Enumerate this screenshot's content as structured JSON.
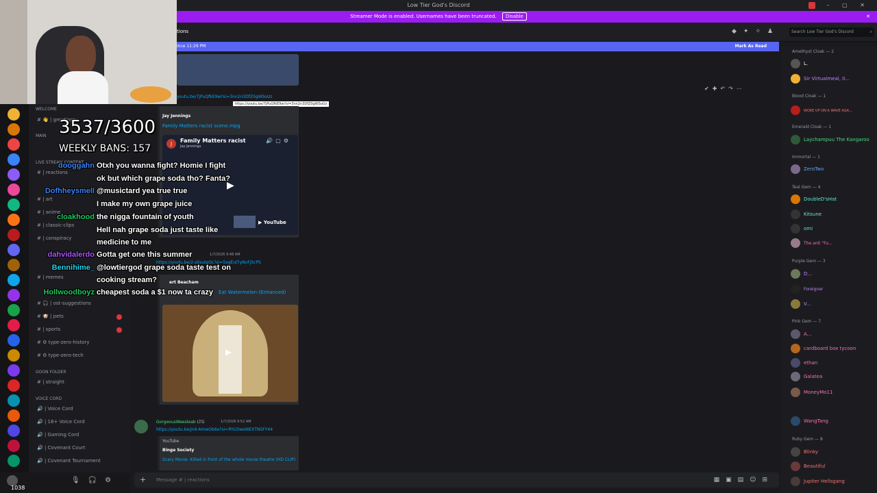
{
  "window": {
    "title": "Low Tier God's Discord"
  },
  "streamer_bar": {
    "text": "Streamer Mode is enabled. Usernames have been truncated.",
    "disable_label": "Disable"
  },
  "header": {
    "channel_partial": "tions",
    "search_placeholder": "Search Low Tier God's Discord"
  },
  "new_messages": {
    "since": "ince 11:29 PM",
    "mark_read": "Mark As Read"
  },
  "overlay": {
    "counter": "3537/3600",
    "weekly_bans": "WEEKLY BANS: 157",
    "chat": [
      {
        "user": "dooggahn",
        "msg": "Otxh you wanna fight? Homie I fight",
        "color": "#3b82f6"
      },
      {
        "user": "",
        "msg": "ok but which grape soda tho? Fanta?",
        "color": "#ffffff"
      },
      {
        "user": "",
        "msg": "@musictard yea true true",
        "color": "#ffffff"
      },
      {
        "user": "Dofhheysmell",
        "msg": "",
        "color": "#3b82f6"
      },
      {
        "user": "",
        "msg": "I make my own grape juice",
        "color": "#ffffff"
      },
      {
        "user": "cloakhood",
        "msg": "the nigga fountain of youth",
        "color": "#22c55e"
      },
      {
        "user": "",
        "msg": "Hell nah grape soda just taste like",
        "color": "#ffffff"
      },
      {
        "user": "",
        "msg": "medicine to me",
        "color": "#ffffff"
      },
      {
        "user": "dahvidalerdo",
        "msg": "Gotta get one this summer",
        "color": "#a855f7"
      },
      {
        "user": "Bennihime_",
        "msg": "@lowtiergod grape soda taste test on",
        "color": "#22d3ee"
      },
      {
        "user": "",
        "msg": "cooking stream?",
        "color": "#ffffff"
      },
      {
        "user": "Hollwoodboyz",
        "msg": "cheapest soda a $1 now ta crazy",
        "color": "#22c55e"
      }
    ]
  },
  "channels": {
    "items": [
      {
        "label": "WELCOME",
        "type": "category"
      },
      {
        "label": "greetings",
        "type": "channel"
      },
      {
        "label": "MAIN",
        "type": "category"
      },
      {
        "label": "LIVE STREAM CONTENT",
        "type": "category"
      },
      {
        "label": "reactions",
        "type": "channel"
      },
      {
        "label": "art",
        "type": "channel"
      },
      {
        "label": "anime",
        "type": "channel"
      },
      {
        "label": "classic-clips",
        "type": "channel"
      },
      {
        "label": "conspiracy",
        "type": "channel"
      },
      {
        "label": "memes",
        "type": "channel"
      },
      {
        "label": "ost-suggestions",
        "type": "channel"
      },
      {
        "label": "pets",
        "type": "channel"
      },
      {
        "label": "sports",
        "type": "channel"
      },
      {
        "label": "type-zero-history",
        "type": "channel"
      },
      {
        "label": "type-zero-tech",
        "type": "channel"
      },
      {
        "label": "GOON FOLDER",
        "type": "category"
      },
      {
        "label": "straight",
        "type": "channel"
      },
      {
        "label": "VOICE CORD",
        "type": "category"
      },
      {
        "label": "Voice Cord",
        "type": "voice"
      },
      {
        "label": "18+ Voice Cord",
        "type": "voice"
      },
      {
        "label": "Gaming Cord",
        "type": "voice"
      },
      {
        "label": "Covenant Court",
        "type": "voice"
      },
      {
        "label": "Covenant Tournament",
        "type": "voice"
      }
    ],
    "user_status": "1038"
  },
  "messages": {
    "link1": "youtu.be/7jPuQfkE9w?si=3nn2n3DfZ0gWSoUz",
    "tooltip": "https://youtu.be/7jPuQfkE9w?si=3nn2n3DfZ0gWSoUz",
    "embed1_author": "Jay Jennings",
    "embed1_title": "Family Matters racist scene.mpg",
    "embed1_video_title": "Family Matters racist",
    "embed1_channel": "Jay Jennings",
    "embed1_youtube": "YouTube",
    "msg2_time": "1/7/2026 9:48 AM",
    "msg2_link": "https://youtu.be/2-sitsutpOc?si=5xgEul7yNxFj5cPS",
    "embed2_author": "ert Beacham",
    "embed2_title": "Eat Watermelon (Enhanced)",
    "msg3_user": "GorgeousWeesleab",
    "msg3_tag": "LTG",
    "msg3_time": "1/7/2026 9:52 AM",
    "msg3_link": "https://youtu.be/jn9-AmwOb6o?si=RYU3weWEXTNSFY44",
    "embed3_provider": "YouTube",
    "embed3_author": "Binge Society",
    "embed3_title": "Scary Movie: Killed in front of the whole movie theatre (HD CLIP)"
  },
  "composer": {
    "placeholder": "Message #",
    "channel": "reactions"
  },
  "members": {
    "groups": [
      {
        "role": "Amethyst Cloak — 2",
        "members": [
          {
            "name": "L.",
            "color": "#ffffff"
          },
          {
            "name": "Sir Virtualmeal, II...",
            "color": "#c084fc"
          }
        ]
      },
      {
        "role": "Blood Cloak — 1",
        "members": [
          {
            "name": "WOKE UP ON A WAVE AGA...",
            "color": "#f87171"
          }
        ]
      },
      {
        "role": "Emerald Cloak — 1",
        "members": [
          {
            "name": "Laychampuu The Kangaroo",
            "color": "#4ade80"
          }
        ]
      },
      {
        "role": "Immortal — 1",
        "members": [
          {
            "name": "ZeroTwo",
            "color": "#60a5fa"
          }
        ]
      },
      {
        "role": "Teal Gem — 4",
        "members": [
          {
            "name": "DoubleD'sHat",
            "color": "#5eead4"
          },
          {
            "name": "Kitsune",
            "color": "#5eead4"
          },
          {
            "name": "omi",
            "color": "#5eead4"
          },
          {
            "name": "The anti \"Fu...",
            "color": "#f472b6"
          }
        ]
      },
      {
        "role": "Purple Gem — 3",
        "members": [
          {
            "name": "D...",
            "color": "#c084fc"
          },
          {
            "name": "Foreigner",
            "color": "#c084fc"
          },
          {
            "name": "V...",
            "color": "#c084fc"
          }
        ]
      },
      {
        "role": "Pink Gem — 7",
        "members": [
          {
            "name": "A...",
            "color": "#f472b6"
          },
          {
            "name": "cardboard box tycoon",
            "color": "#f472b6"
          },
          {
            "name": "ethan",
            "color": "#f472b6"
          },
          {
            "name": "Galatea",
            "color": "#f472b6"
          },
          {
            "name": "MoneyMo11",
            "color": "#f472b6"
          },
          {
            "name": "WangTang",
            "color": "#f472b6"
          }
        ]
      },
      {
        "role": "Ruby Gem — 8",
        "members": [
          {
            "name": "Blinky",
            "color": "#f87171"
          },
          {
            "name": "Beautiful",
            "color": "#f87171"
          },
          {
            "name": "Jupiter Hellsgang",
            "color": "#f87171"
          }
        ]
      }
    ]
  },
  "colors": {
    "accent": "#5865f2",
    "streamer_bar": "#9b1cf0",
    "link": "#00a8fc",
    "unread": "#da373c"
  }
}
